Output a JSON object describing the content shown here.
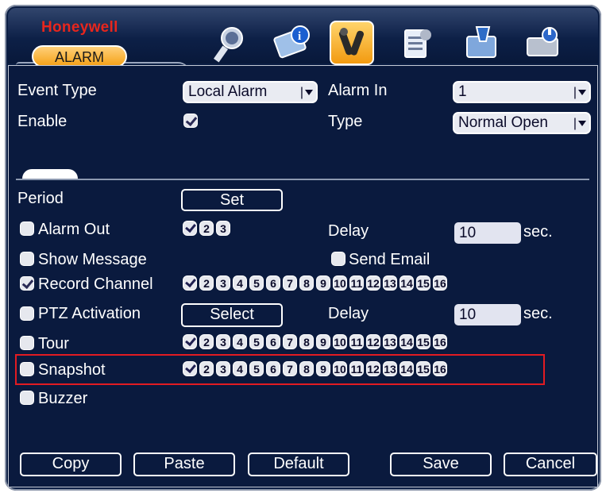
{
  "header": {
    "brand": "Honeywell",
    "active_tab": "ALARM",
    "icons": [
      "search-icon",
      "info-icon",
      "settings-icon",
      "account-icon",
      "tools-icon",
      "disk-icon"
    ]
  },
  "form": {
    "event_type_label": "Event Type",
    "event_type_value": "Local Alarm",
    "alarm_in_label": "Alarm In",
    "alarm_in_value": "1",
    "enable_label": "Enable",
    "type_label": "Type",
    "type_value": "Normal Open",
    "period_label": "Period",
    "set_button": "Set",
    "alarm_out_label": "Alarm Out",
    "alarm_out_channels": [
      "1",
      "2",
      "3"
    ],
    "delay1_label": "Delay",
    "delay1_value": "10",
    "sec1": "sec.",
    "show_message_label": "Show Message",
    "send_email_label": "Send Email",
    "record_channel_label": "Record Channel",
    "ptz_label": "PTZ Activation",
    "select_button": "Select",
    "delay2_label": "Delay",
    "delay2_value": "10",
    "sec2": "sec.",
    "tour_label": "Tour",
    "snapshot_label": "Snapshot",
    "buzzer_label": "Buzzer",
    "channels": [
      "1",
      "2",
      "3",
      "4",
      "5",
      "6",
      "7",
      "8",
      "9",
      "10",
      "11",
      "12",
      "13",
      "14",
      "15",
      "16"
    ]
  },
  "footer": {
    "copy": "Copy",
    "paste": "Paste",
    "default": "Default",
    "save": "Save",
    "cancel": "Cancel"
  },
  "colors": {
    "background": "#0a1a3e",
    "accent": "#f5a117",
    "highlight": "#e21b22"
  }
}
